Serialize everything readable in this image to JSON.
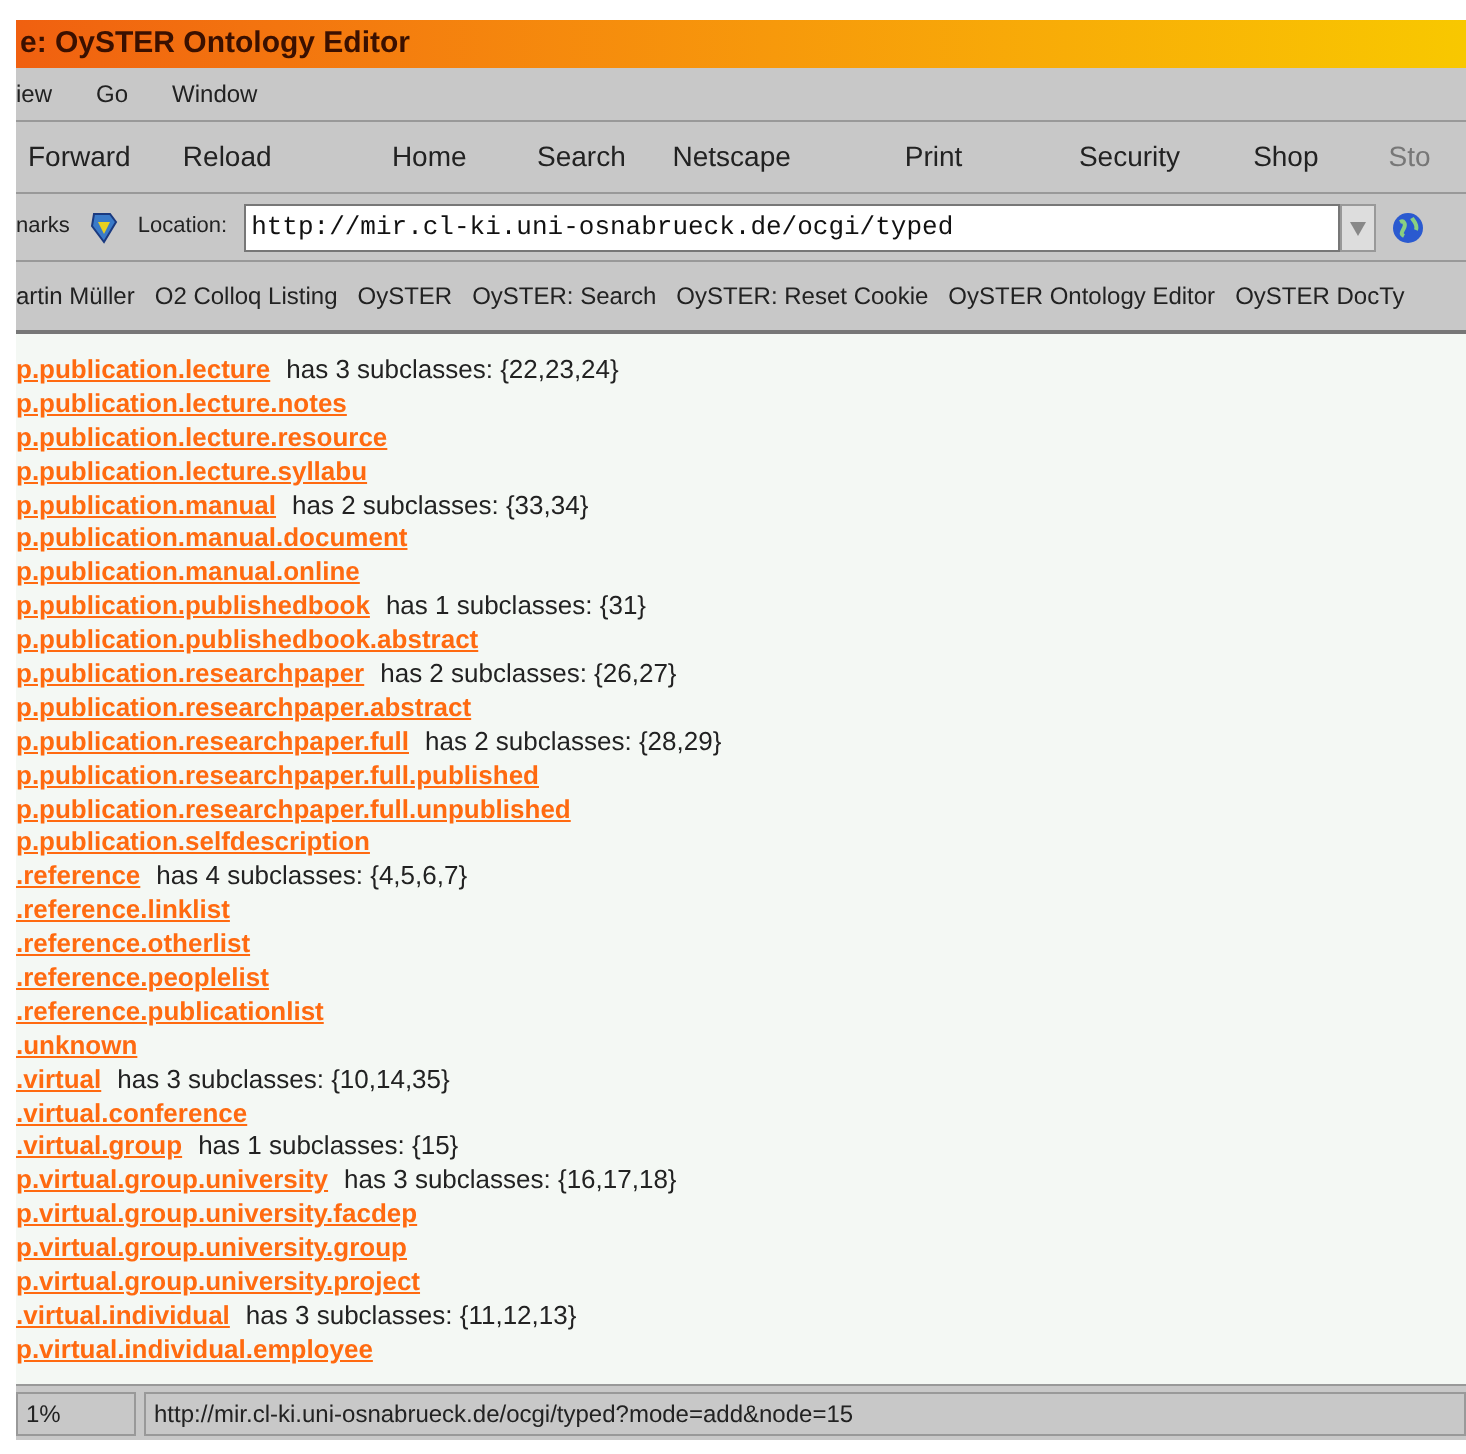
{
  "window": {
    "title": "e: OySTER Ontology Editor"
  },
  "menu": [
    "iew",
    "Go",
    "Window"
  ],
  "toolbar": [
    {
      "label": "Forward",
      "disabled": false
    },
    {
      "label": "Reload",
      "disabled": false
    },
    {
      "label": "Home",
      "disabled": false
    },
    {
      "label": "Search",
      "disabled": false
    },
    {
      "label": "Netscape",
      "disabled": false
    },
    {
      "label": "Print",
      "disabled": false
    },
    {
      "label": "Security",
      "disabled": false
    },
    {
      "label": "Shop",
      "disabled": false
    },
    {
      "label": "Sto",
      "disabled": true
    }
  ],
  "location": {
    "bookmarks_label": "narks",
    "label": "Location:",
    "value": "http://mir.cl-ki.uni-osnabrueck.de/ocgi/typed"
  },
  "personal_bookmarks": [
    "artin Müller",
    "O2 Colloq Listing",
    "OySTER",
    "OySTER: Search",
    "OySTER: Reset Cookie",
    "OySTER Ontology Editor",
    "OySTER DocTy"
  ],
  "classes": [
    {
      "link": "p.publication.lecture",
      "info": "has 3 subclasses: {22,23,24}"
    },
    {
      "link": "p.publication.lecture.notes"
    },
    {
      "link": "p.publication.lecture.resource"
    },
    {
      "link": "p.publication.lecture.syllabu"
    },
    {
      "link": "p.publication.manual",
      "info": "has 2 subclasses: {33,34}"
    },
    {
      "link": "p.publication.manual.document"
    },
    {
      "link": "p.publication.manual.online"
    },
    {
      "link": "p.publication.publishedbook",
      "info": "has 1 subclasses: {31}"
    },
    {
      "link": "p.publication.publishedbook.abstract"
    },
    {
      "link": "p.publication.researchpaper",
      "info": "has 2 subclasses: {26,27}"
    },
    {
      "link": "p.publication.researchpaper.abstract"
    },
    {
      "link": "p.publication.researchpaper.full",
      "info": "has 2 subclasses: {28,29}"
    },
    {
      "link": "p.publication.researchpaper.full.published"
    },
    {
      "link": "p.publication.researchpaper.full.unpublished"
    },
    {
      "link": "p.publication.selfdescription"
    },
    {
      "link": ".reference",
      "info": "has 4 subclasses: {4,5,6,7}"
    },
    {
      "link": ".reference.linklist"
    },
    {
      "link": ".reference.otherlist"
    },
    {
      "link": ".reference.peoplelist"
    },
    {
      "link": ".reference.publicationlist"
    },
    {
      "link": ".unknown"
    },
    {
      "link": ".virtual",
      "info": "has 3 subclasses: {10,14,35}"
    },
    {
      "link": ".virtual.conference"
    },
    {
      "link": ".virtual.group",
      "info": "has 1 subclasses: {15}"
    },
    {
      "link": "p.virtual.group.university",
      "info": "has 3 subclasses: {16,17,18}"
    },
    {
      "link": "p.virtual.group.university.facdep"
    },
    {
      "link": "p.virtual.group.university.group"
    },
    {
      "link": "p.virtual.group.university.project"
    },
    {
      "link": ".virtual.individual",
      "info": "has 3 subclasses: {11,12,13}"
    },
    {
      "link": "p.virtual.individual.employee"
    }
  ],
  "status_bar": {
    "progress": "1%",
    "url": "http://mir.cl-ki.uni-osnabrueck.de/ocgi/typed?mode=add&node=15"
  }
}
